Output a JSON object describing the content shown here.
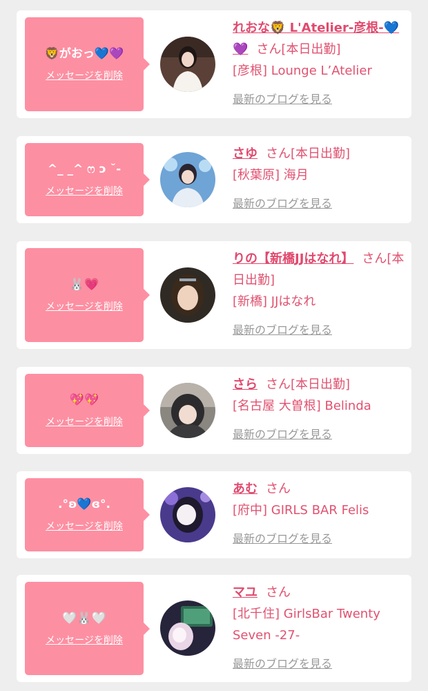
{
  "messages": [
    {
      "message": "🦁がおっ💙💜",
      "delete_label": "メッセージを削除",
      "name": "れおな🦁 L'Atelier-彦根-💙💜",
      "honorific": "さん",
      "status": "[本日出勤]",
      "shop": "[彦根] Lounge L’Atelier",
      "blog_label": "最新のブログを見る",
      "avatar_icon": "woman-photo-avatar"
    },
    {
      "message": "^_ _^ ෆ ɔ ˘-",
      "delete_label": "メッセージを削除",
      "name": "さゆ",
      "honorific": "さん",
      "status": "[本日出勤]",
      "shop": "[秋葉原] 海月",
      "blog_label": "最新のブログを見る",
      "avatar_icon": "woman-photo-avatar"
    },
    {
      "message": "🐰💗",
      "delete_label": "メッセージを削除",
      "name": "りの【新橋JJはなれ】",
      "honorific": "さん",
      "status": "[本日出勤]",
      "shop": "[新橋] JJはなれ",
      "blog_label": "最新のブログを見る",
      "avatar_icon": "woman-photo-avatar"
    },
    {
      "message": "💖💖",
      "delete_label": "メッセージを削除",
      "name": "さら",
      "honorific": "さん",
      "status": "[本日出勤]",
      "shop": "[名古屋 大曽根] Belinda",
      "blog_label": "最新のブログを見る",
      "avatar_icon": "woman-photo-avatar"
    },
    {
      "message": ".°ʚ💙ɞ°.",
      "delete_label": "メッセージを削除",
      "name": "あむ",
      "honorific": "さん",
      "status": "",
      "shop": "[府中] GIRLS BAR Felis",
      "blog_label": "最新のブログを見る",
      "avatar_icon": "woman-photo-avatar"
    },
    {
      "message": "🤍🐰🤍",
      "delete_label": "メッセージを削除",
      "name": "マユ",
      "honorific": "さん",
      "status": "",
      "shop": "[北千住] GirlsBar Twenty Seven -27-",
      "blog_label": "最新のブログを見る",
      "avatar_icon": "woman-photo-avatar"
    }
  ],
  "colors": {
    "accent": "#e04a6e",
    "bubble": "#fd8fa2",
    "link_gray": "#999999",
    "background": "#eeeeee"
  }
}
